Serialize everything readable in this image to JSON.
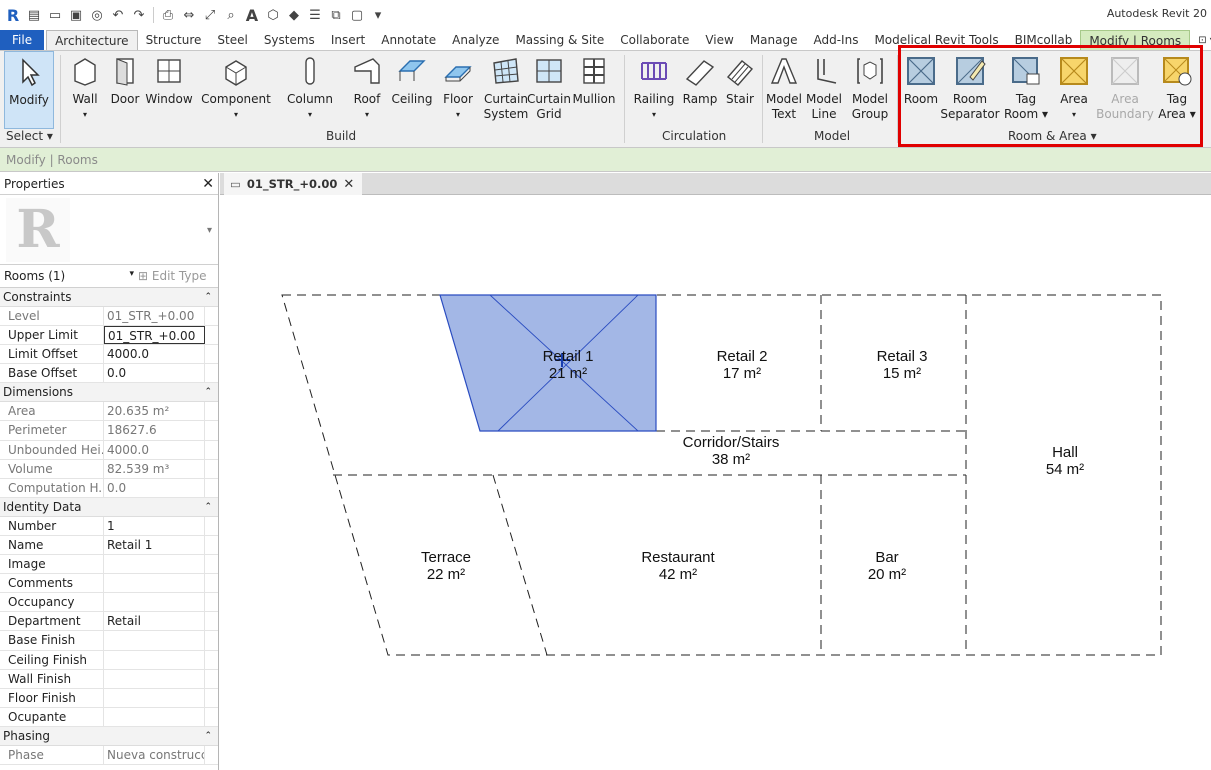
{
  "app": {
    "title": "Autodesk Revit 20"
  },
  "ribbon_tabs": [
    "File",
    "Architecture",
    "Structure",
    "Steel",
    "Systems",
    "Insert",
    "Annotate",
    "Analyze",
    "Massing & Site",
    "Collaborate",
    "View",
    "Manage",
    "Add-Ins",
    "Modelical Revit Tools",
    "BIMcollab",
    "Modify | Rooms"
  ],
  "ribbon": {
    "select": {
      "modify": "Modify",
      "select_label": "Select ▾"
    },
    "build": {
      "label": "Build",
      "wall": "Wall",
      "door": "Door",
      "window": "Window",
      "component": "Component",
      "column": "Column",
      "roof": "Roof",
      "ceiling": "Ceiling",
      "floor": "Floor",
      "curtain_system_1": "Curtain",
      "curtain_system_2": "System",
      "curtain_grid_1": "Curtain",
      "curtain_grid_2": "Grid",
      "mullion": "Mullion"
    },
    "circulation": {
      "label": "Circulation",
      "railing": "Railing",
      "ramp": "Ramp",
      "stair": "Stair"
    },
    "model": {
      "label": "Model",
      "model_text_1": "Model",
      "model_text_2": "Text",
      "model_line_1": "Model",
      "model_line_2": "Line",
      "model_group_1": "Model",
      "model_group_2": "Group"
    },
    "room_area": {
      "label": "Room & Area ▾",
      "room": "Room",
      "room_sep_1": "Room",
      "room_sep_2": "Separator",
      "tag_room_1": "Tag",
      "tag_room_2": "Room",
      "area": "Area",
      "area_boundary_1": "Area",
      "area_boundary_2": "Boundary",
      "tag_area_1": "Tag",
      "tag_area_2": "Area"
    }
  },
  "options_bar": {
    "text": "Modify | Rooms"
  },
  "properties": {
    "title": "Properties",
    "instance_selector": "Rooms (1)",
    "edit_type": "Edit Type",
    "groups": {
      "constraints": "Constraints",
      "dimensions": "Dimensions",
      "identity": "Identity Data",
      "phasing": "Phasing"
    },
    "rows": {
      "level": {
        "k": "Level",
        "v": "01_STR_+0.00"
      },
      "upper_limit": {
        "k": "Upper Limit",
        "v": "01_STR_+0.00"
      },
      "limit_offset": {
        "k": "Limit Offset",
        "v": "4000.0"
      },
      "base_offset": {
        "k": "Base Offset",
        "v": "0.0"
      },
      "area": {
        "k": "Area",
        "v": "20.635 m²"
      },
      "perimeter": {
        "k": "Perimeter",
        "v": "18627.6"
      },
      "unbounded": {
        "k": "Unbounded Hei...",
        "v": "4000.0"
      },
      "volume": {
        "k": "Volume",
        "v": "82.539 m³"
      },
      "computation": {
        "k": "Computation H...",
        "v": "0.0"
      },
      "number": {
        "k": "Number",
        "v": "1"
      },
      "name": {
        "k": "Name",
        "v": "Retail 1"
      },
      "image": {
        "k": "Image",
        "v": ""
      },
      "comments": {
        "k": "Comments",
        "v": ""
      },
      "occupancy": {
        "k": "Occupancy",
        "v": ""
      },
      "department": {
        "k": "Department",
        "v": "Retail"
      },
      "base_finish": {
        "k": "Base Finish",
        "v": ""
      },
      "ceiling_finish": {
        "k": "Ceiling Finish",
        "v": ""
      },
      "wall_finish": {
        "k": "Wall Finish",
        "v": ""
      },
      "floor_finish": {
        "k": "Floor Finish",
        "v": ""
      },
      "ocupante": {
        "k": "Ocupante",
        "v": ""
      },
      "phase": {
        "k": "Phase",
        "v": "Nueva construcci..."
      }
    }
  },
  "view": {
    "tab_title": "01_STR_+0.00"
  },
  "rooms": [
    {
      "name": "Retail 1",
      "area": "21 m²"
    },
    {
      "name": "Retail 2",
      "area": "17 m²"
    },
    {
      "name": "Retail 3",
      "area": "15 m²"
    },
    {
      "name": "Corridor/Stairs",
      "area": "38 m²"
    },
    {
      "name": "Hall",
      "area": "54 m²"
    },
    {
      "name": "Terrace",
      "area": "22 m²"
    },
    {
      "name": "Restaurant",
      "area": "42 m²"
    },
    {
      "name": "Bar",
      "area": "20 m²"
    }
  ],
  "colors": {
    "selection_fill": "#a3b7e6",
    "selection_stroke": "#2a4cc0",
    "highlight": "#e00000",
    "file_tab": "#1f5fbf",
    "context_tab": "#d5ebbf"
  }
}
